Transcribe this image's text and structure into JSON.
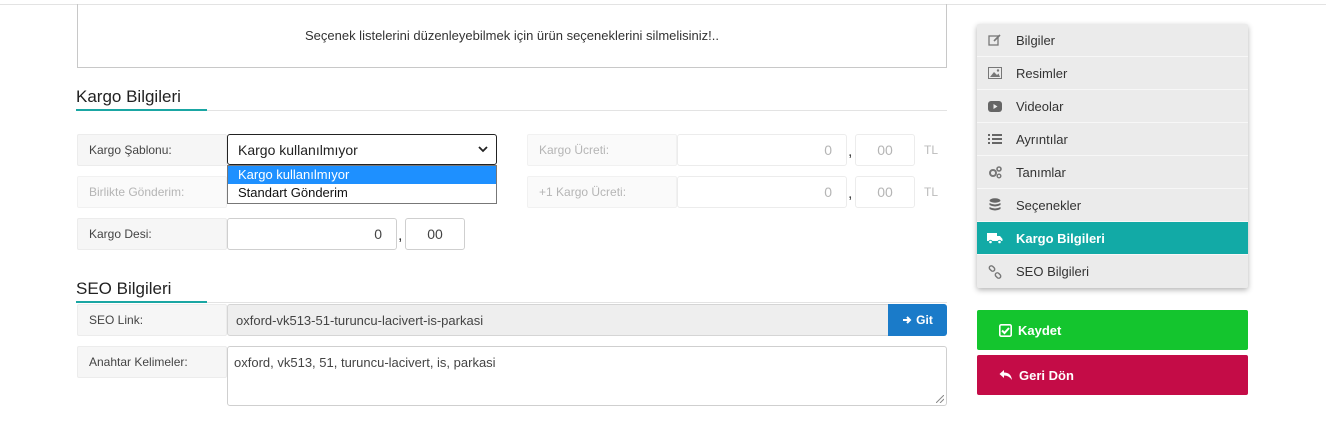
{
  "notice": "Seçenek listelerini düzenleyebilmek için ürün seçeneklerini silmelisiniz!..",
  "cargo": {
    "title": "Kargo Bilgileri",
    "template_label": "Kargo Şablonu:",
    "template_value": "Kargo kullanılmıyor",
    "template_options": [
      "Kargo kullanılmıyor",
      "Standart Gönderim"
    ],
    "together_label": "Birlikte Gönderim:",
    "desi_label": "Kargo Desi:",
    "desi_int": "0",
    "desi_dec": "00",
    "fee_label": "Kargo Ücreti:",
    "fee_int": "0",
    "fee_dec": "00",
    "plus_fee_label": "+1 Kargo Ücreti:",
    "plus_fee_int": "0",
    "plus_fee_dec": "00",
    "currency": "TL",
    "comma": ","
  },
  "seo": {
    "title": "SEO Bilgileri",
    "link_label": "SEO Link:",
    "link_value": "oxford-vk513-51-turuncu-lacivert-is-parkasi",
    "go_label": "Git",
    "keywords_label": "Anahtar Kelimeler:",
    "keywords_value": "oxford, vk513, 51, turuncu-lacivert, is, parkasi"
  },
  "sidebar": {
    "items": [
      {
        "label": "Bilgiler",
        "icon": "edit-icon"
      },
      {
        "label": "Resimler",
        "icon": "image-icon"
      },
      {
        "label": "Videolar",
        "icon": "youtube-icon"
      },
      {
        "label": "Ayrıntılar",
        "icon": "list-icon"
      },
      {
        "label": "Tanımlar",
        "icon": "cogs-icon"
      },
      {
        "label": "Seçenekler",
        "icon": "database-icon"
      },
      {
        "label": "Kargo Bilgileri",
        "icon": "truck-icon",
        "active": true
      },
      {
        "label": "SEO Bilgileri",
        "icon": "link-icon"
      }
    ]
  },
  "actions": {
    "save_label": "Kaydet",
    "back_label": "Geri Dön"
  },
  "colors": {
    "accent": "#12aaa6",
    "save": "#14c52e",
    "back": "#c40c47",
    "go": "#1a7bc9",
    "dropdown_selected": "#1e90ff"
  }
}
